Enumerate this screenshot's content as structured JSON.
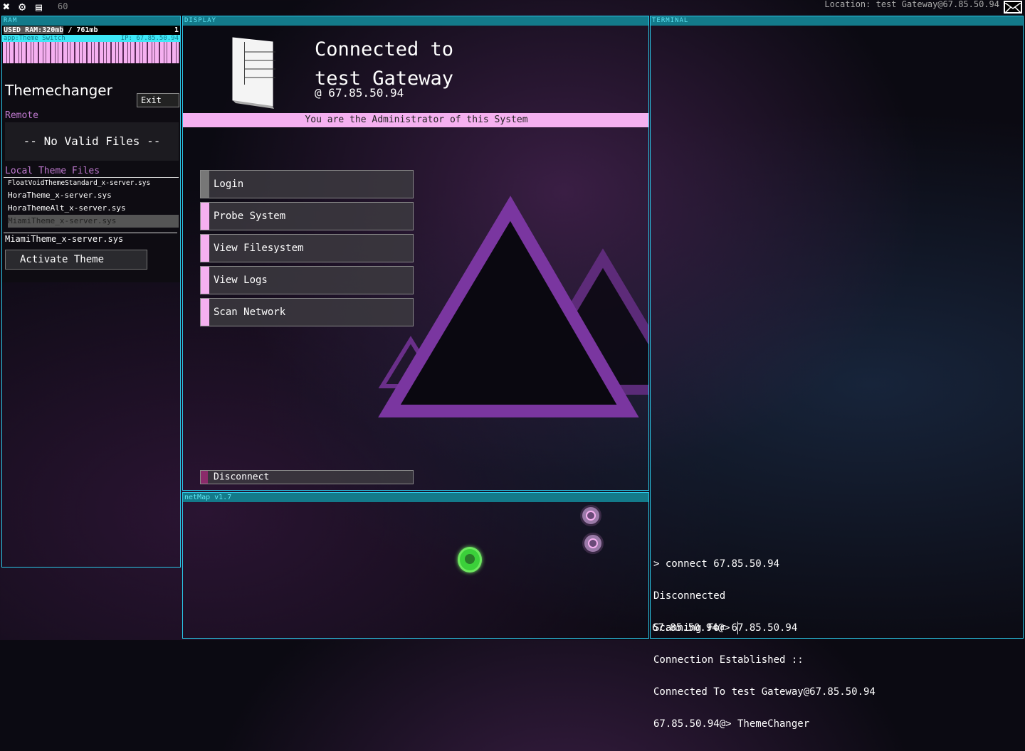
{
  "topbar": {
    "icons": [
      "close-icon",
      "gear-icon",
      "save-icon"
    ],
    "fps": "60",
    "location": "Location: test Gateway@67.85.50.94",
    "mail_icon": "envelope-icon"
  },
  "ram": {
    "header": "RAM",
    "used_label": "USED RAM:",
    "used": "320mb",
    "total": "/ 761mb",
    "count": "1",
    "app": {
      "name": "app:Theme Switch",
      "ip": "IP: 67.85.50.94",
      "title": "Themechanger",
      "exit": "Exit",
      "remote_label": "Remote",
      "no_files": "-- No Valid Files --",
      "local_label": "Local Theme Files",
      "files": [
        "FloatVoidThemeStandard_x-server.sys",
        "HoraTheme_x-server.sys",
        "HoraThemeAlt_x-server.sys",
        "MiamiTheme_x-server.sys"
      ],
      "selected_file": "MiamiTheme_x-server.sys",
      "activate": "Activate Theme"
    }
  },
  "display": {
    "header": "DISPLAY",
    "connected_line1": "Connected to",
    "connected_line2": "test Gateway",
    "ip": "@  67.85.50.94",
    "admin_banner": "You are the Administrator of this System",
    "buttons": [
      "Login",
      "Probe System",
      "View Filesystem",
      "View Logs",
      "Scan Network"
    ],
    "disconnect": "Disconnect"
  },
  "netmap": {
    "header": "netMap v1.7"
  },
  "terminal": {
    "header": "TERMINAL",
    "lines": [
      "> connect 67.85.50.94",
      "Disconnected",
      "Scanning For 67.85.50.94",
      "Connection Established ::",
      "Connected To test Gateway@67.85.50.94",
      "67.85.50.94@> ThemeChanger"
    ],
    "prompt": "67.85.50.94@>"
  },
  "colors": {
    "accent": "#2ac8e8",
    "header": "#137a8a",
    "pink": "#f5b0f0"
  }
}
